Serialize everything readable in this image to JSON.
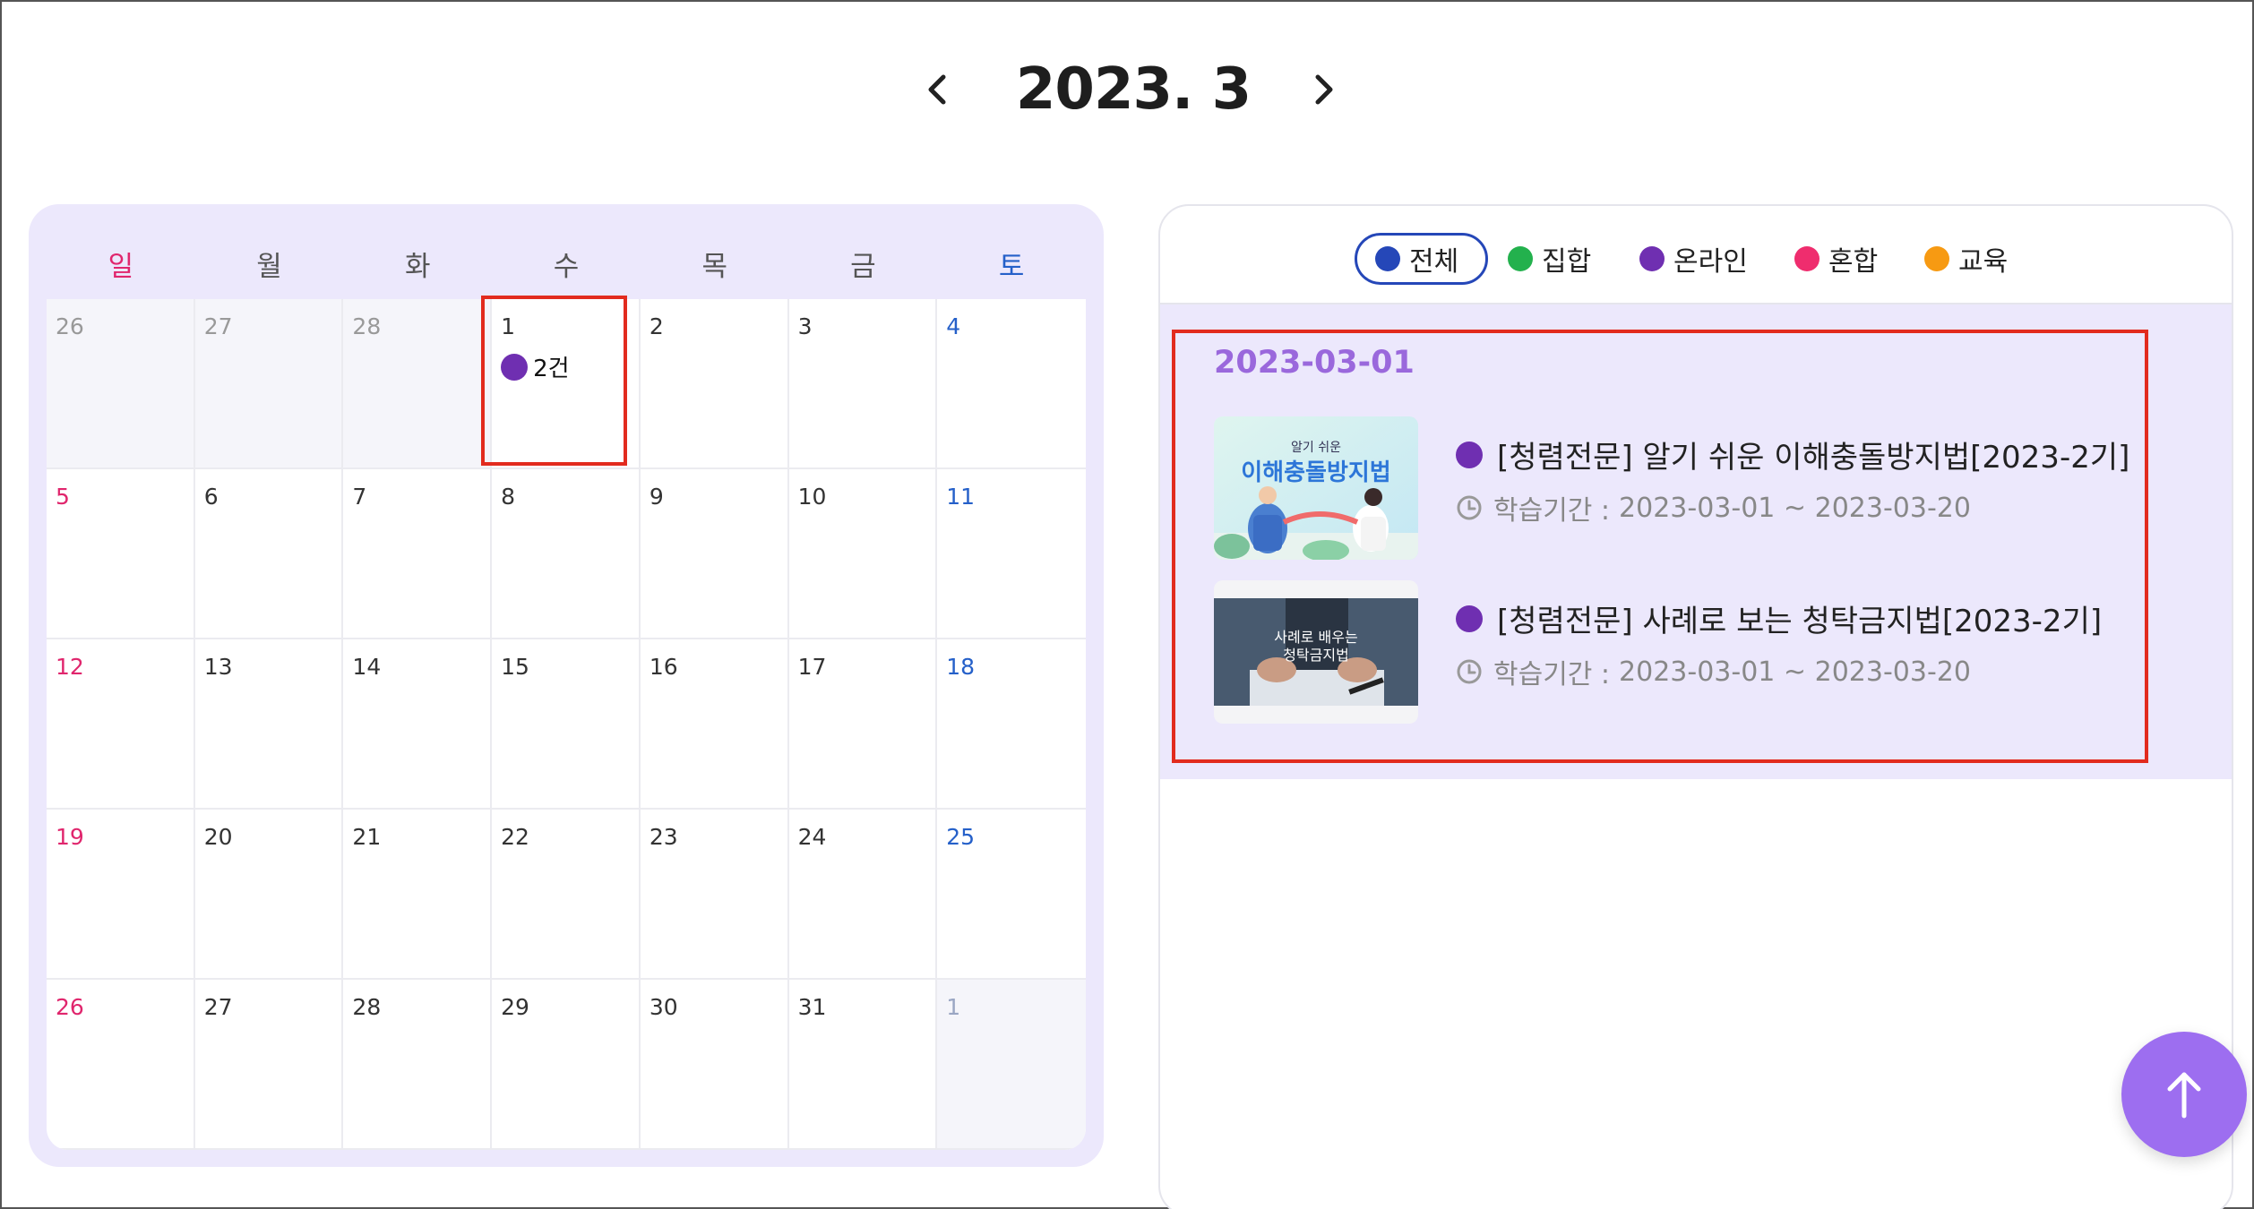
{
  "header": {
    "month_title": "2023. 3",
    "prev_icon": "chevron-left-icon",
    "next_icon": "chevron-right-icon"
  },
  "calendar": {
    "weekdays": [
      "일",
      "월",
      "화",
      "수",
      "목",
      "금",
      "토"
    ],
    "weeks": [
      [
        {
          "d": "26",
          "other": true
        },
        {
          "d": "27",
          "other": true
        },
        {
          "d": "28",
          "other": true
        },
        {
          "d": "1",
          "events": "2건"
        },
        {
          "d": "2"
        },
        {
          "d": "3"
        },
        {
          "d": "4"
        }
      ],
      [
        {
          "d": "5"
        },
        {
          "d": "6"
        },
        {
          "d": "7"
        },
        {
          "d": "8"
        },
        {
          "d": "9"
        },
        {
          "d": "10"
        },
        {
          "d": "11"
        }
      ],
      [
        {
          "d": "12"
        },
        {
          "d": "13"
        },
        {
          "d": "14"
        },
        {
          "d": "15"
        },
        {
          "d": "16"
        },
        {
          "d": "17"
        },
        {
          "d": "18"
        }
      ],
      [
        {
          "d": "19"
        },
        {
          "d": "20"
        },
        {
          "d": "21"
        },
        {
          "d": "22"
        },
        {
          "d": "23"
        },
        {
          "d": "24"
        },
        {
          "d": "25"
        }
      ],
      [
        {
          "d": "26"
        },
        {
          "d": "27"
        },
        {
          "d": "28"
        },
        {
          "d": "29"
        },
        {
          "d": "30"
        },
        {
          "d": "31"
        },
        {
          "d": "1",
          "other": true
        }
      ]
    ]
  },
  "filters": [
    {
      "label": "전체",
      "color": "#2547b8",
      "active": true
    },
    {
      "label": "집합",
      "color": "#23b14d"
    },
    {
      "label": "온라인",
      "color": "#6f2fb1"
    },
    {
      "label": "혼합",
      "color": "#ef2d6e"
    },
    {
      "label": "교육",
      "color": "#f79a12"
    }
  ],
  "schedule": {
    "date": "2023-03-01",
    "courses": [
      {
        "title": "[청렴전문] 알기 쉬운 이해충돌방지법[2023-2기]",
        "period_label": "학습기간 :",
        "period": "2023-03-01 ~ 2023-03-20",
        "thumb_small": "알기 쉬운",
        "thumb_big": "이해충돌방지법"
      },
      {
        "title": "[청렴전문] 사례로 보는 청탁금지법[2023-2기]",
        "period_label": "학습기간 :",
        "period": "2023-03-01 ~ 2023-03-20",
        "thumb_small": "사례로 배우는",
        "thumb_big": "청탁금지법"
      }
    ]
  },
  "colors": {
    "online_dot": "#6f2fb1",
    "accent_purple": "#9d6ef0",
    "sunday": "#e0266d",
    "saturday": "#2560c9",
    "highlight": "#e22b1e"
  },
  "top_button_icon": "arrow-up-icon"
}
